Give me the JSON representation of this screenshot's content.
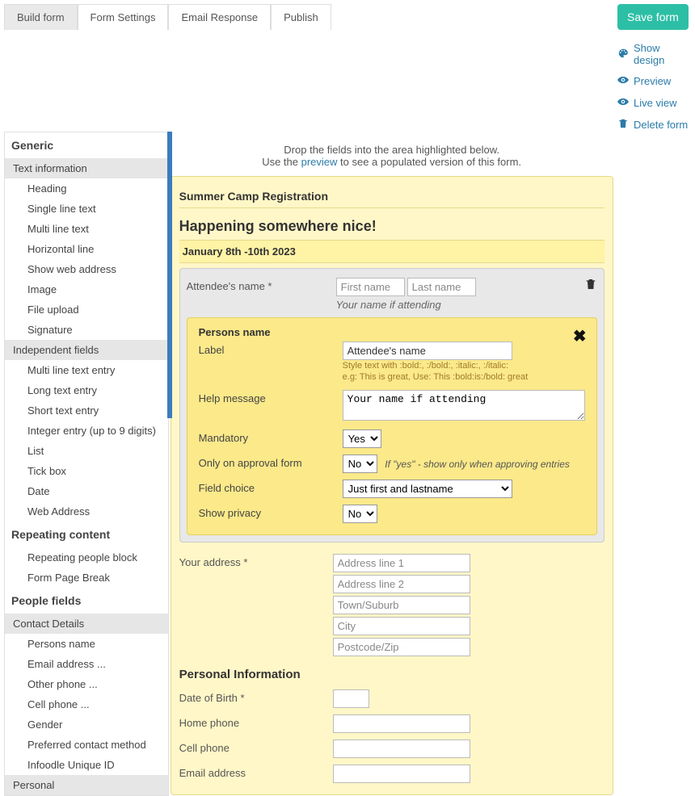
{
  "tabs": {
    "build": "Build form",
    "settings": "Form Settings",
    "email": "Email Response",
    "publish": "Publish"
  },
  "save_label": "Save form",
  "right_links": {
    "showdesign": "Show design",
    "preview": "Preview",
    "liveview": "Live view",
    "deleteform": "Delete form"
  },
  "sidebar": {
    "generic": "Generic",
    "text_info": "Text information",
    "ti": {
      "heading": "Heading",
      "single": "Single line text",
      "multi": "Multi line text",
      "hr": "Horizontal line",
      "showweb": "Show web address",
      "image": "Image",
      "upload": "File upload",
      "signature": "Signature"
    },
    "indep": "Independent fields",
    "ind": {
      "multi": "Multi line text entry",
      "long": "Long text entry",
      "short": "Short text entry",
      "int": "Integer entry (up to 9 digits)",
      "list": "List",
      "tick": "Tick box",
      "date": "Date",
      "web": "Web Address"
    },
    "repeating": "Repeating content",
    "rep": {
      "block": "Repeating people block",
      "pagebreak": "Form Page Break"
    },
    "people": "People fields",
    "contact": "Contact Details",
    "cd": {
      "persons": "Persons name",
      "email": "Email address ...",
      "otherphone": "Other phone ...",
      "cellphone": "Cell phone ...",
      "gender": "Gender",
      "pcm": "Preferred contact method",
      "uid": "Infoodle Unique ID"
    },
    "personal": "Personal"
  },
  "builder": {
    "hint1": "Drop the fields into the area highlighted below.",
    "hint2a": "Use the ",
    "hint2b": "preview",
    "hint2c": " to see a populated version of this form.",
    "title": "Summer Camp Registration",
    "subtitle": "Happening somewhere nice!",
    "dates": "January 8th -10th 2023",
    "attendee_label": "Attendee's name *",
    "first_ph": "First name",
    "last_ph": "Last name",
    "attendee_help": "Your name if attending",
    "editor": {
      "title": "Persons name",
      "label_l": "Label",
      "label_v": "Attendee's name",
      "style1": "Style text with :bold:, :/bold:, :italic:, :/italic:",
      "style2": "e.g: This is great, Use: This :bold:is:/bold: great",
      "help_l": "Help message",
      "help_v": "Your name if attending",
      "mand_l": "Mandatory",
      "mand_v": "Yes",
      "approval_l": "Only on approval form",
      "approval_v": "No",
      "approval_note": "If \"yes\" - show only when approving entries",
      "choice_l": "Field choice",
      "choice_v": "Just first and lastname",
      "privacy_l": "Show privacy",
      "privacy_v": "No"
    },
    "address_label": "Your address *",
    "addr": {
      "l1": "Address line 1",
      "l2": "Address line 2",
      "town": "Town/Suburb",
      "city": "City",
      "zip": "Postcode/Zip"
    },
    "personal_h": "Personal Information",
    "dob_l": "Date of Birth *",
    "home_l": "Home phone",
    "cell_l": "Cell phone",
    "email_l": "Email address"
  }
}
